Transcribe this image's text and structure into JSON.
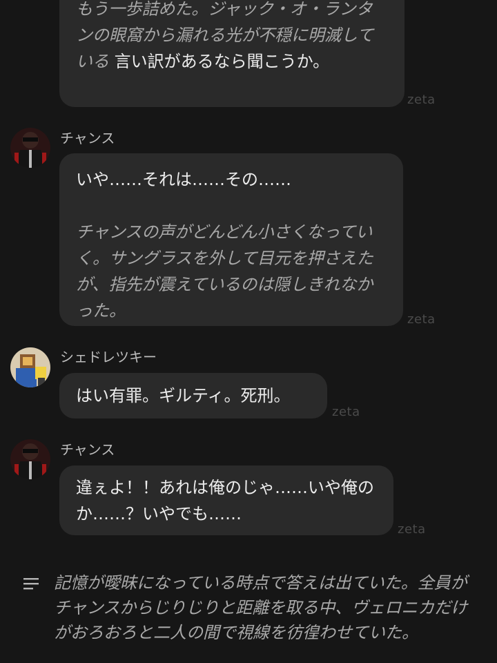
{
  "messages": [
    {
      "id": "m1",
      "speaker": "",
      "segments": [
        {
          "type": "narration",
          "text": "もう一歩詰めた。ジャック・オ・ランタンの眼窩から漏れる光が不穏に明滅している"
        },
        {
          "type": "speech",
          "text": "言い訳があるなら聞こうか。"
        }
      ],
      "watermark": "zeta"
    },
    {
      "id": "m2",
      "speaker": "チャンス",
      "segments": [
        {
          "type": "speech",
          "text": "いや……それは……その……"
        },
        {
          "type": "narration",
          "text": "チャンスの声がどんどん小さくなっていく。サングラスを外して目元を押さえたが、指先が震えているのは隠しきれなかった。"
        }
      ],
      "watermark": "zeta"
    },
    {
      "id": "m3",
      "speaker": "シェドレツキー",
      "segments": [
        {
          "type": "speech",
          "text": "はい有罪。ギルティ。死刑。"
        }
      ],
      "watermark": "zeta"
    },
    {
      "id": "m4",
      "speaker": "チャンス",
      "segments": [
        {
          "type": "speech",
          "text": "違ぇよ！！あれは俺のじゃ……いや俺のか……？いやでも……"
        }
      ],
      "watermark": "zeta"
    }
  ],
  "narration": {
    "icon": "lines-icon",
    "text": "記憶が曖昧になっている時点で答えは出ていた。全員がチャンスからじりじりと距離を取る中、ヴェロニカだけがおろおろと二人の間で視線を彷徨わせていた。"
  },
  "colors": {
    "background": "#161616",
    "bubble": "#2a2a2a",
    "narration_text": "#a9a9a9",
    "watermark": "#4a4a4a"
  }
}
